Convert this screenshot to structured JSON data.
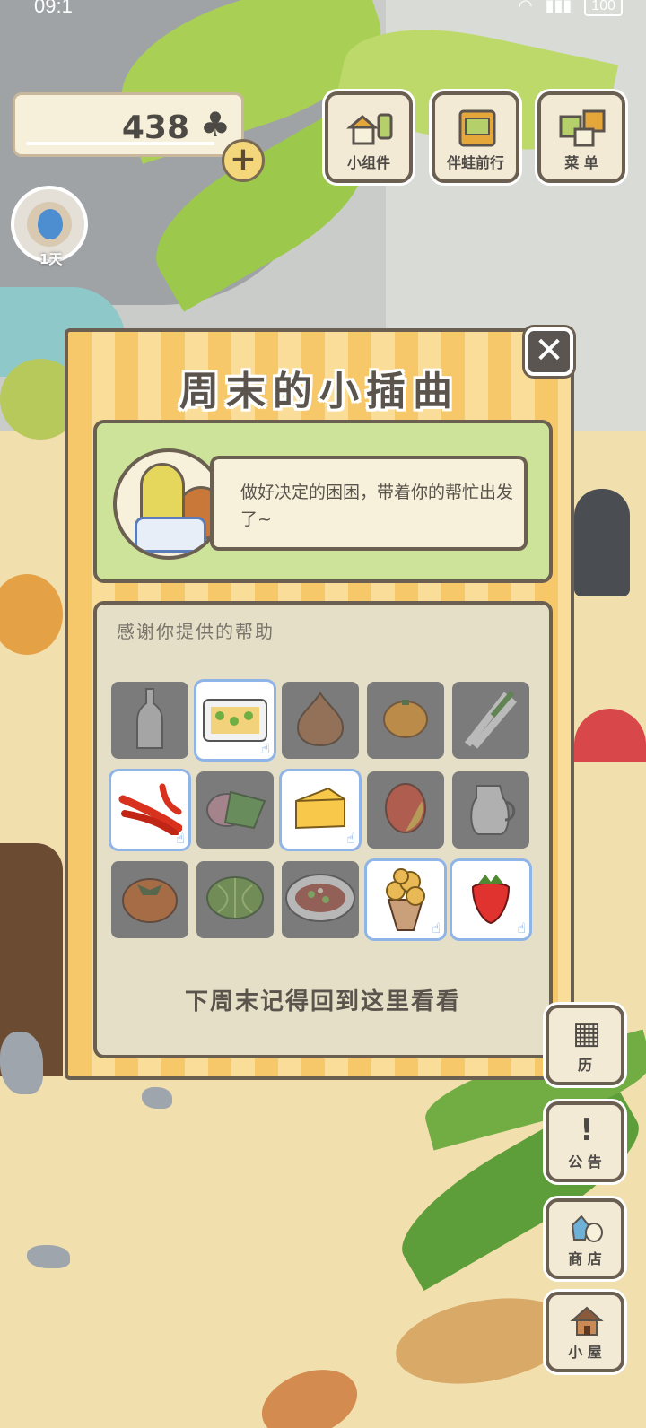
{
  "status_bar": {
    "time": "09:1",
    "battery": "100"
  },
  "clover_counter": {
    "value": "438",
    "icon": "clover-icon"
  },
  "top_menu": [
    {
      "label": "小组件",
      "icon": "widget-icon"
    },
    {
      "label": "伴蛙前行",
      "icon": "journey-book-icon"
    },
    {
      "label": "菜 单",
      "icon": "menu-cards-icon"
    }
  ],
  "visitor": {
    "day_label": "1天"
  },
  "side_menu": [
    {
      "label": "历",
      "icon": "calendar-icon"
    },
    {
      "label": "公 告",
      "icon": "notice-icon"
    },
    {
      "label": "商 店",
      "icon": "shop-bag-icon"
    },
    {
      "label": "小 屋",
      "icon": "house-icon"
    }
  ],
  "dialog": {
    "title": "周末的小插曲",
    "message": "做好决定的困困，带着你的帮忙出发了~",
    "help_heading": "感谢你提供的帮助",
    "footer_note": "下周末记得回到这里看看",
    "items": [
      {
        "name": "bottle",
        "selected": false
      },
      {
        "name": "bento-box",
        "selected": true
      },
      {
        "name": "onion",
        "selected": false
      },
      {
        "name": "orange",
        "selected": false
      },
      {
        "name": "green-onion",
        "selected": false
      },
      {
        "name": "chili-peppers",
        "selected": true
      },
      {
        "name": "rice-cake",
        "selected": false
      },
      {
        "name": "cheese",
        "selected": true
      },
      {
        "name": "mango",
        "selected": false
      },
      {
        "name": "milk-jug",
        "selected": false
      },
      {
        "name": "persimmon",
        "selected": false
      },
      {
        "name": "cabbage",
        "selected": false
      },
      {
        "name": "salad-plate",
        "selected": false
      },
      {
        "name": "nuts-cone",
        "selected": true
      },
      {
        "name": "strawberry",
        "selected": true
      }
    ]
  },
  "colors": {
    "dialog_stripe_a": "#f7c86a",
    "dialog_stripe_b": "#fbdd9a",
    "message_panel": "#cde39a",
    "selected_border": "#8fb4e8"
  }
}
